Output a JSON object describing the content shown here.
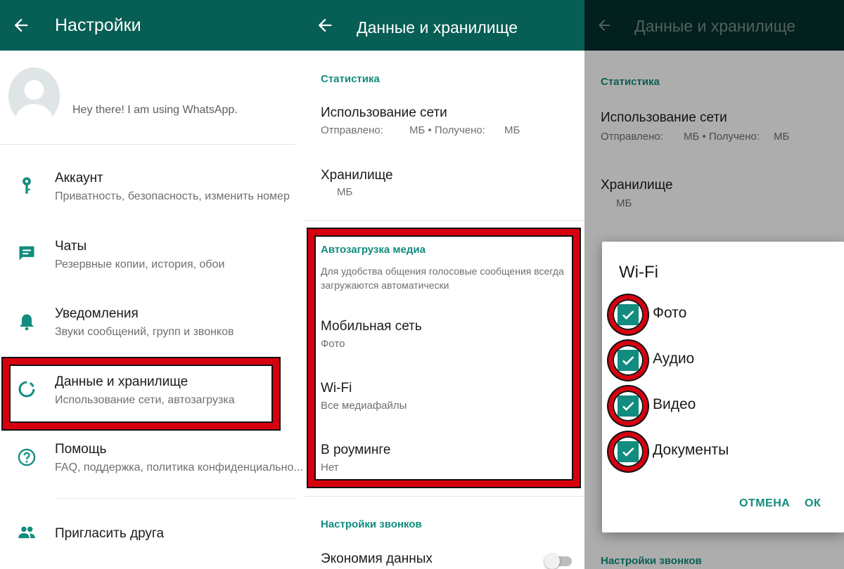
{
  "colors": {
    "appbar": "#075e54",
    "accent": "#128c7e",
    "highlight": "#d7000f"
  },
  "settings": {
    "title": "Настройки",
    "profile_status": "Hey there! I am using WhatsApp.",
    "items": [
      {
        "icon": "key-icon",
        "title": "Аккаунт",
        "subtitle": "Приватность, безопасность, изменить номер"
      },
      {
        "icon": "chat-icon",
        "title": "Чаты",
        "subtitle": "Резервные копии, история, обои"
      },
      {
        "icon": "bell-icon",
        "title": "Уведомления",
        "subtitle": "Звуки сообщений, групп и звонков"
      },
      {
        "icon": "data-usage-icon",
        "title": "Данные и хранилище",
        "subtitle": "Использование сети, автозагрузка"
      },
      {
        "icon": "help-icon",
        "title": "Помощь",
        "subtitle": "FAQ, поддержка, политика конфиденциально..."
      },
      {
        "icon": "people-icon",
        "title": "Пригласить друга",
        "subtitle": ""
      }
    ]
  },
  "data_storage": {
    "title": "Данные и хранилище",
    "stats_header": "Статистика",
    "network_usage": {
      "title": "Использование сети",
      "sent_label": "Отправлено:",
      "sent_unit": "МБ • Получено:",
      "received_unit": "МБ"
    },
    "storage": {
      "title": "Хранилище",
      "value": "МБ"
    },
    "autodownload": {
      "header": "Автозагрузка медиа",
      "description_line1": "Для удобства общения голосовые сообщения всегда",
      "description_line2": "загружаются автоматически",
      "mobile": {
        "title": "Мобильная сеть",
        "value": "Фото"
      },
      "wifi": {
        "title": "Wi-Fi",
        "value": "Все медиафайлы"
      },
      "roaming": {
        "title": "В роуминге",
        "value": "Нет"
      }
    },
    "calls_header": "Настройки звонков",
    "data_saver": "Экономия данных",
    "data_saver_on": false
  },
  "wifi_dialog": {
    "title": "Wi-Fi",
    "options": [
      {
        "label": "Фото",
        "checked": true
      },
      {
        "label": "Аудио",
        "checked": true
      },
      {
        "label": "Видео",
        "checked": true
      },
      {
        "label": "Документы",
        "checked": true
      }
    ],
    "cancel": "ОТМЕНА",
    "ok": "ОК"
  }
}
